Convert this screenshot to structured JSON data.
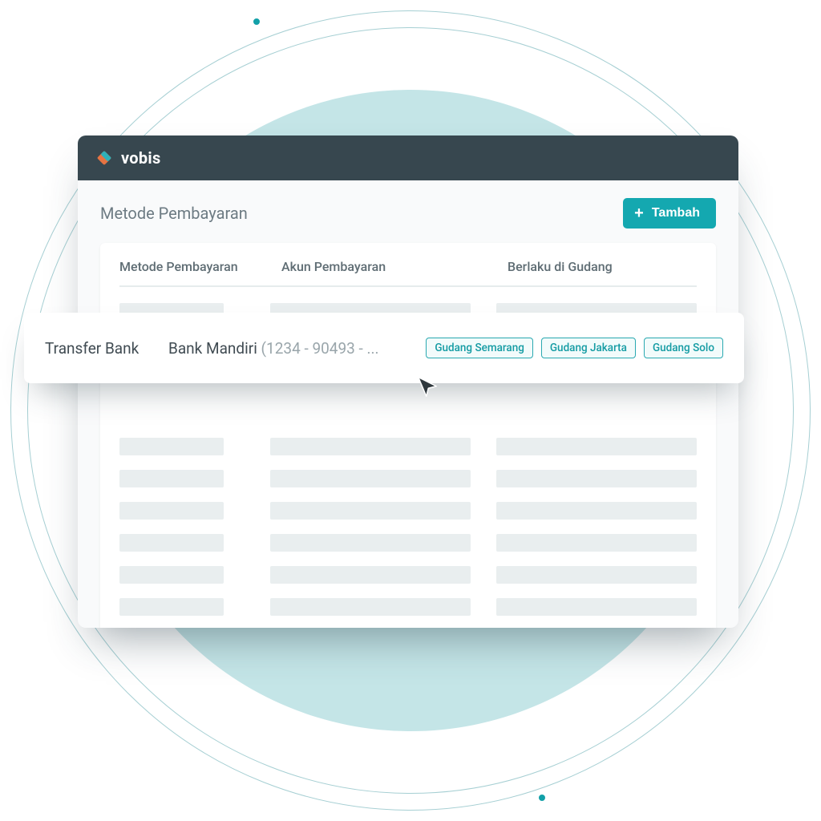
{
  "app": {
    "name": "vobis"
  },
  "page": {
    "title": "Metode Pembayaran",
    "add_button_label": "Tambah"
  },
  "table": {
    "columns": {
      "method": "Metode Pembayaran",
      "account": "Akun Pembayaran",
      "warehouses": "Berlaku di Gudang"
    }
  },
  "highlighted_row": {
    "method": "Transfer Bank",
    "account_name": "Bank Mandiri",
    "account_number_truncated": "(1234 - 90493 - ...",
    "warehouses": [
      "Gudang Semarang",
      "Gudang Jakarta",
      "Gudang Solo"
    ]
  },
  "colors": {
    "primary": "#14a8b0",
    "header_bg": "#37474f",
    "bg_circle": "#c4e5e7"
  }
}
